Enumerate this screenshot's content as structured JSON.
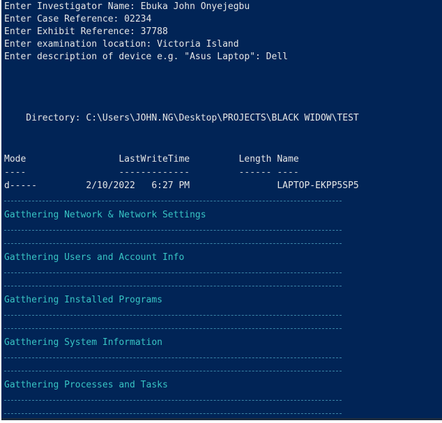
{
  "prompts": [
    "Enter Investigator Name: Ebuka John Onyejegbu",
    "Enter Case Reference: 02234",
    "Enter Exhibit Reference: 37788",
    "Enter examination location: Victoria Island",
    "Enter description of device e.g. \"Asus Laptop\": Dell"
  ],
  "directory": "    Directory: C:\\Users\\JOHN.NG\\Desktop\\PROJECTS\\BLACK WIDOW\\TEST",
  "listing": {
    "header": "Mode                 LastWriteTime         Length Name",
    "underline": "----                 -------------         ------ ----",
    "row": "d-----         2/10/2022   6:27 PM                LAPTOP-EKPP5SP5"
  },
  "steps": [
    "Gatthering Network & Network Settings",
    "Gatthering Users and Account Info",
    "Gatthering Installed Programs",
    "Gatthering System Information",
    "Gatthering Processes and Tasks"
  ],
  "colors": {
    "background": "#012456",
    "foreground": "#e6e6e6",
    "accent": "#38c4c4"
  }
}
